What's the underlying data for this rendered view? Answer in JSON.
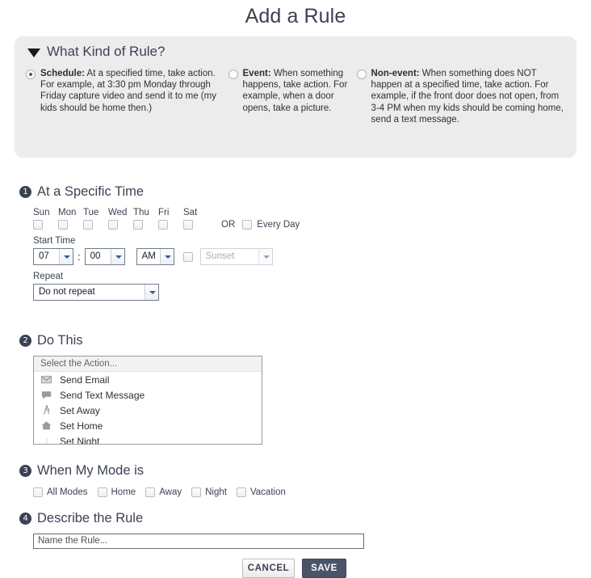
{
  "page_title": "Add a Rule",
  "kind_panel": {
    "header": "What Kind of Rule?",
    "collapse_icon": "triangle-down-icon",
    "options": [
      {
        "id": "schedule",
        "label": "Schedule:",
        "description": " At a specified time, take action. For example, at 3:30 pm Monday through Friday capture video and send it to me (my kids should be home then.)",
        "selected": true
      },
      {
        "id": "event",
        "label": "Event:",
        "description": " When something happens, take action. For example, when a door opens, take a picture.",
        "selected": false
      },
      {
        "id": "non-event",
        "label": "Non-event:",
        "description": " When something does NOT happen at a specified time, take action. For example, if the front door does not open, from 3-4 PM when my kids should be coming home, send a text message.",
        "selected": false
      }
    ]
  },
  "step1": {
    "number": "1",
    "title": "At a Specific Time",
    "days": [
      "Sun",
      "Mon",
      "Tue",
      "Wed",
      "Thu",
      "Fri",
      "Sat"
    ],
    "or_label": "OR",
    "every_day_label": "Every Day",
    "start_time_label": "Start Time",
    "hour_value": "07",
    "minute_value": "00",
    "meridiem_value": "AM",
    "sunset_value": "Sunset",
    "repeat_label": "Repeat",
    "repeat_value": "Do not repeat"
  },
  "step2": {
    "number": "2",
    "title": "Do This",
    "placeholder": "Select the Action...",
    "actions": [
      {
        "label": "Send Email",
        "icon": "envelope-icon"
      },
      {
        "label": "Send Text Message",
        "icon": "speech-bubble-icon"
      },
      {
        "label": "Set Away",
        "icon": "walking-person-icon"
      },
      {
        "label": "Set Home",
        "icon": "house-icon"
      },
      {
        "label": "Set Night",
        "icon": "crescent-moon-icon"
      }
    ]
  },
  "step3": {
    "number": "3",
    "title": "When My Mode is",
    "modes": [
      "All Modes",
      "Home",
      "Away",
      "Night",
      "Vacation"
    ]
  },
  "step4": {
    "number": "4",
    "title": "Describe the Rule",
    "name_placeholder": "Name the Rule..."
  },
  "buttons": {
    "cancel": "CANCEL",
    "save": "SAVE",
    "save_color": "#4a5468"
  }
}
